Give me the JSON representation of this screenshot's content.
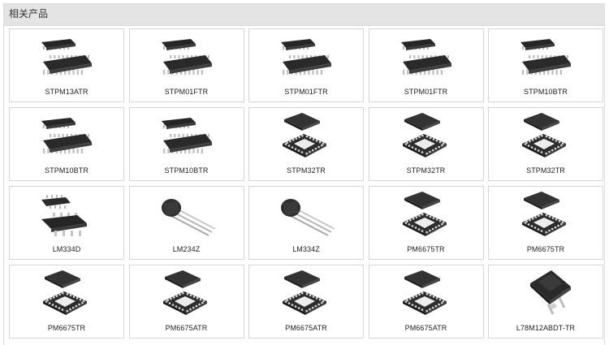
{
  "section": {
    "title": "相关产品"
  },
  "products": [
    {
      "name": "STPM13ATR",
      "package": "tssop"
    },
    {
      "name": "STPM01FTR",
      "package": "tssop"
    },
    {
      "name": "STPM01FTR",
      "package": "tssop"
    },
    {
      "name": "STPM01FTR",
      "package": "tssop"
    },
    {
      "name": "STPM10BTR",
      "package": "tssop"
    },
    {
      "name": "STPM10BTR",
      "package": "tssop"
    },
    {
      "name": "STPM10BTR",
      "package": "tssop"
    },
    {
      "name": "STPM32TR",
      "package": "qfn"
    },
    {
      "name": "STPM32TR",
      "package": "qfn"
    },
    {
      "name": "STPM32TR",
      "package": "qfn"
    },
    {
      "name": "LM334D",
      "package": "soic"
    },
    {
      "name": "LM234Z",
      "package": "to92"
    },
    {
      "name": "LM334Z",
      "package": "to92"
    },
    {
      "name": "PM6675TR",
      "package": "qfn"
    },
    {
      "name": "PM6675TR",
      "package": "qfn"
    },
    {
      "name": "PM6675TR",
      "package": "qfn"
    },
    {
      "name": "PM6675ATR",
      "package": "qfn"
    },
    {
      "name": "PM6675ATR",
      "package": "qfn"
    },
    {
      "name": "PM6675ATR",
      "package": "qfn"
    },
    {
      "name": "L78M12ABDT-TR",
      "package": "dpak"
    }
  ],
  "colors": {
    "chip_body": "#2f2f2f",
    "chip_top": "#3c3c3c",
    "lead": "#bdbdbd",
    "pad": "#e9e9e9"
  }
}
